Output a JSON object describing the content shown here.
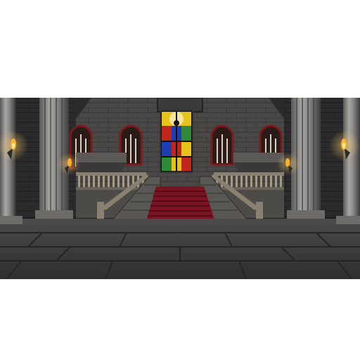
{
  "scene": {
    "type": "3d-castle-hall",
    "elements": [
      "stone-walls",
      "fluted-columns",
      "stained-glass-window",
      "arched-windows",
      "grand-staircase",
      "red-carpet",
      "balustrades",
      "wall-torches",
      "stone-tile-floor"
    ]
  },
  "colors": {
    "letterbox": "#ffffff",
    "wall": "#4a4846",
    "wall_dark": "#2a2a2c",
    "floor": "#3e3e3e",
    "carpet": "#7a1420",
    "column": "#8a8886",
    "torch_flame": "#ffb030",
    "glass_red": "#c0261c",
    "glass_blue": "#1f3fb0",
    "glass_yellow": "#e6c21a",
    "glass_green": "#2f8a3a"
  },
  "icons": [
    "torch-icon",
    "stained-glass-icon"
  ]
}
